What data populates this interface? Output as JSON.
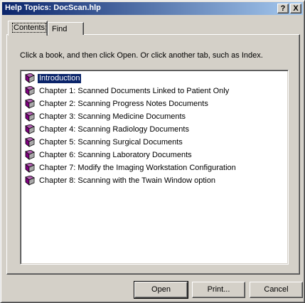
{
  "window": {
    "title": "Help Topics: DocScan.hlp",
    "help_glyph": "?",
    "close_glyph": "X"
  },
  "tabs": [
    {
      "label": "Contents",
      "active": true
    },
    {
      "label": "Find",
      "active": false
    }
  ],
  "instructions": "Click a book, and then click Open. Or click another tab, such as Index.",
  "contents": {
    "icon": "closed-book-icon",
    "items": [
      {
        "label": "Introduction",
        "selected": true
      },
      {
        "label": "Chapter 1: Scanned Documents Linked to Patient Only"
      },
      {
        "label": "Chapter 2: Scanning Progress Notes Documents"
      },
      {
        "label": "Chapter 3: Scanning Medicine Documents"
      },
      {
        "label": "Chapter 4: Scanning Radiology Documents"
      },
      {
        "label": "Chapter 5: Scanning Surgical Documents"
      },
      {
        "label": "Chapter 6: Scanning Laboratory Documents"
      },
      {
        "label": "Chapter 7: Modify the Imaging Workstation Configuration"
      },
      {
        "label": "Chapter 8: Scanning with the Twain Window option"
      }
    ]
  },
  "buttons": {
    "open": "Open",
    "print": "Print...",
    "cancel": "Cancel"
  },
  "colors": {
    "title_bar_start": "#0a246a",
    "title_bar_end": "#a6caf0",
    "face": "#d4d0c8",
    "selection": "#0a246a",
    "book": "#800080"
  }
}
